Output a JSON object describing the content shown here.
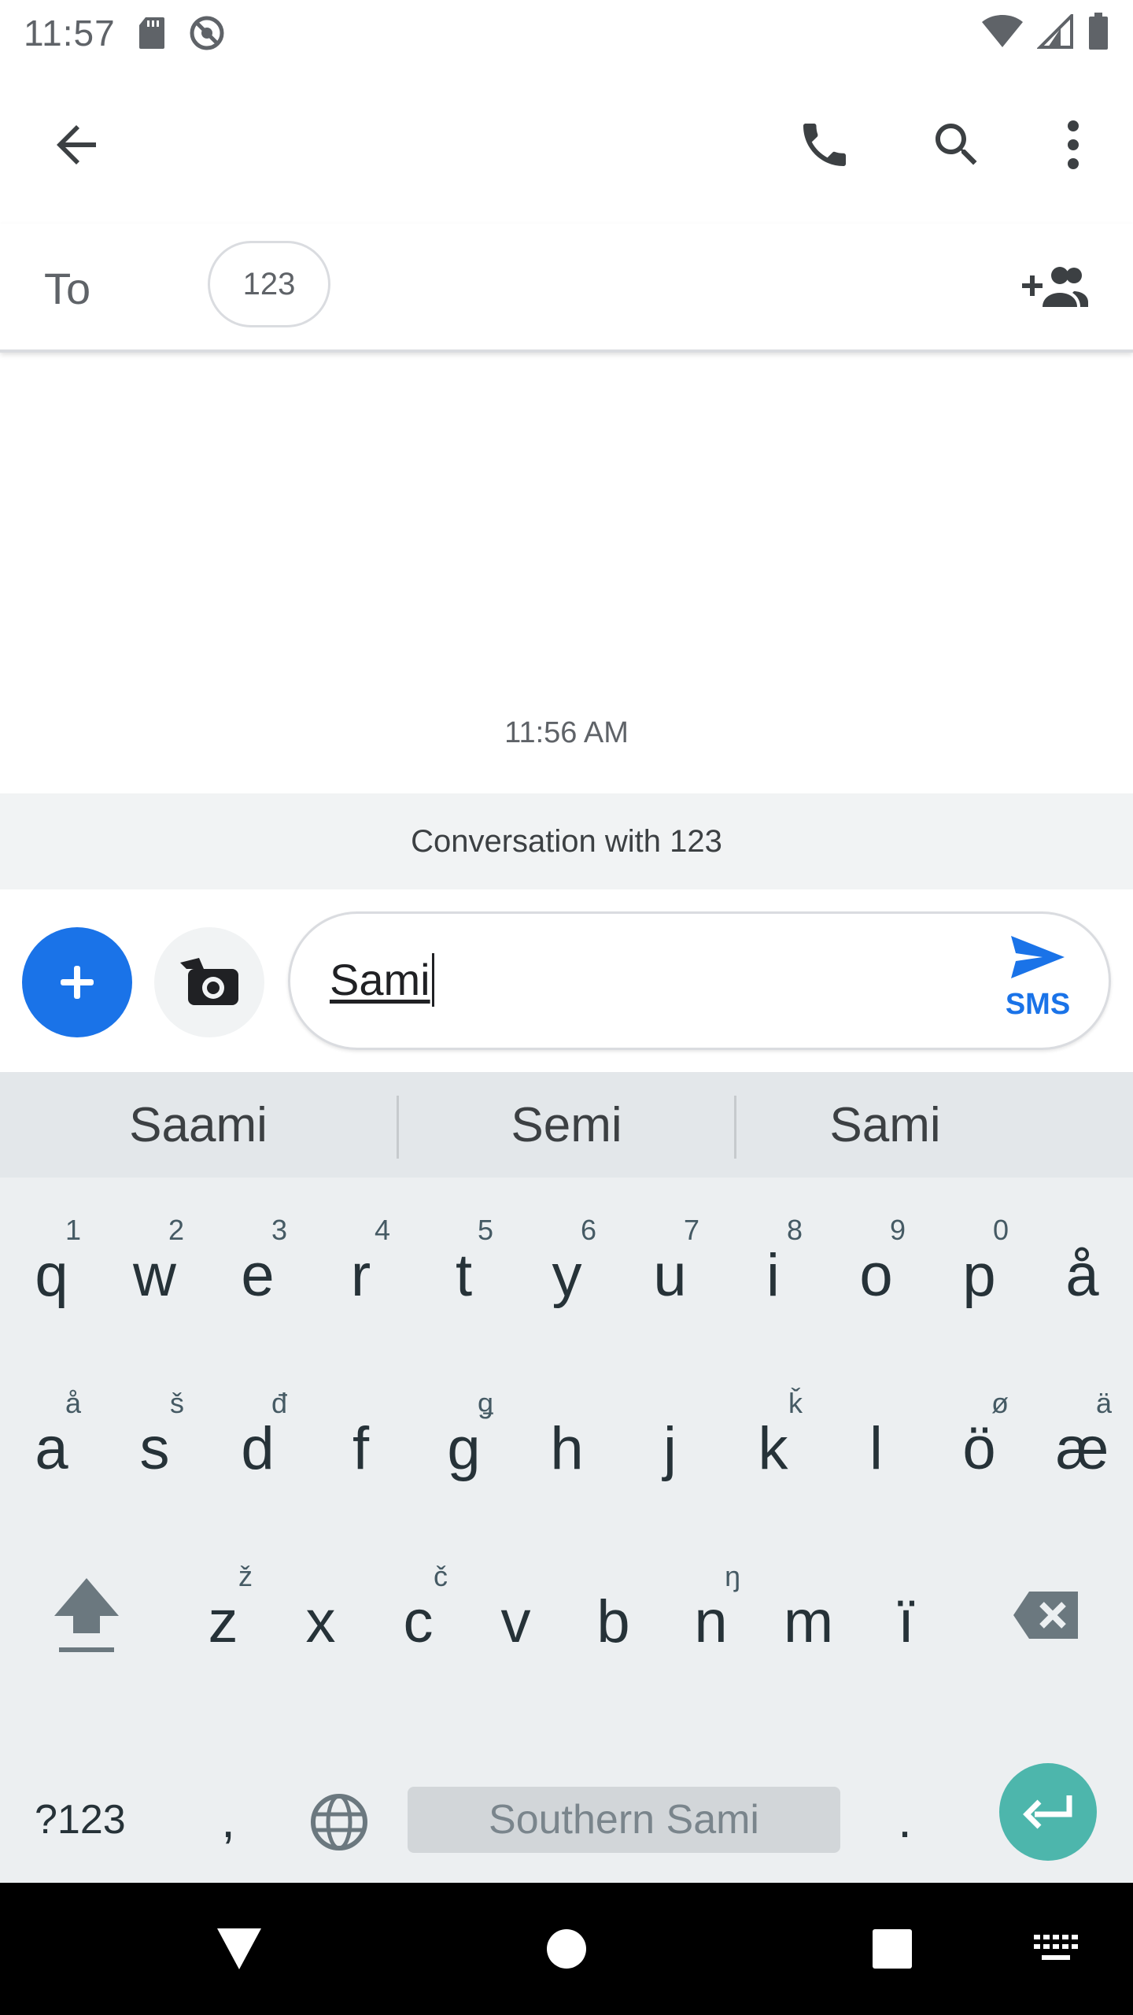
{
  "status_bar": {
    "time": "11:57",
    "left_icons": [
      "sd-card-icon",
      "no-disturb-icon"
    ],
    "right_icons": [
      "wifi-icon",
      "signal-icon",
      "battery-icon"
    ]
  },
  "app_bar": {
    "icons": [
      "back-arrow-icon",
      "phone-icon",
      "search-icon",
      "more-vert-icon"
    ]
  },
  "to_row": {
    "label": "To",
    "recipient": "123"
  },
  "conversation": {
    "timestamp": "11:56 AM",
    "banner": "Conversation with 123"
  },
  "compose": {
    "message_value": "Sami",
    "send_label": "SMS"
  },
  "keyboard": {
    "suggestions": [
      "Saami",
      "Semi",
      "Sami"
    ],
    "row1": [
      {
        "key": "q",
        "hint": "1"
      },
      {
        "key": "w",
        "hint": "2"
      },
      {
        "key": "e",
        "hint": "3"
      },
      {
        "key": "r",
        "hint": "4"
      },
      {
        "key": "t",
        "hint": "5"
      },
      {
        "key": "y",
        "hint": "6"
      },
      {
        "key": "u",
        "hint": "7"
      },
      {
        "key": "i",
        "hint": "8"
      },
      {
        "key": "o",
        "hint": "9"
      },
      {
        "key": "p",
        "hint": "0"
      },
      {
        "key": "å",
        "hint": ""
      }
    ],
    "row2": [
      {
        "key": "a",
        "hint": "å"
      },
      {
        "key": "s",
        "hint": "š"
      },
      {
        "key": "d",
        "hint": "đ"
      },
      {
        "key": "f",
        "hint": ""
      },
      {
        "key": "g",
        "hint": "ǥ"
      },
      {
        "key": "h",
        "hint": ""
      },
      {
        "key": "j",
        "hint": ""
      },
      {
        "key": "k",
        "hint": "ǩ"
      },
      {
        "key": "l",
        "hint": ""
      },
      {
        "key": "ö",
        "hint": "ø"
      },
      {
        "key": "æ",
        "hint": "ä"
      }
    ],
    "row3": [
      {
        "key": "z",
        "hint": "ž"
      },
      {
        "key": "x",
        "hint": ""
      },
      {
        "key": "c",
        "hint": "č"
      },
      {
        "key": "v",
        "hint": ""
      },
      {
        "key": "b",
        "hint": ""
      },
      {
        "key": "n",
        "hint": "ŋ"
      },
      {
        "key": "m",
        "hint": ""
      },
      {
        "key": "ï",
        "hint": ""
      }
    ],
    "symbols_label": "?123",
    "comma_label": ",",
    "space_label": "Southern Sami",
    "period_label": ".",
    "accent_color": "#4db6ac"
  },
  "nav_bar": {
    "icons": [
      "back-triangle-icon",
      "home-circle-icon",
      "recents-square-icon",
      "keyboard-switch-icon"
    ]
  },
  "colors": {
    "primary": "#1a73e8",
    "keyboard_bg": "#eceff1",
    "banner_bg": "#f1f3f4"
  }
}
